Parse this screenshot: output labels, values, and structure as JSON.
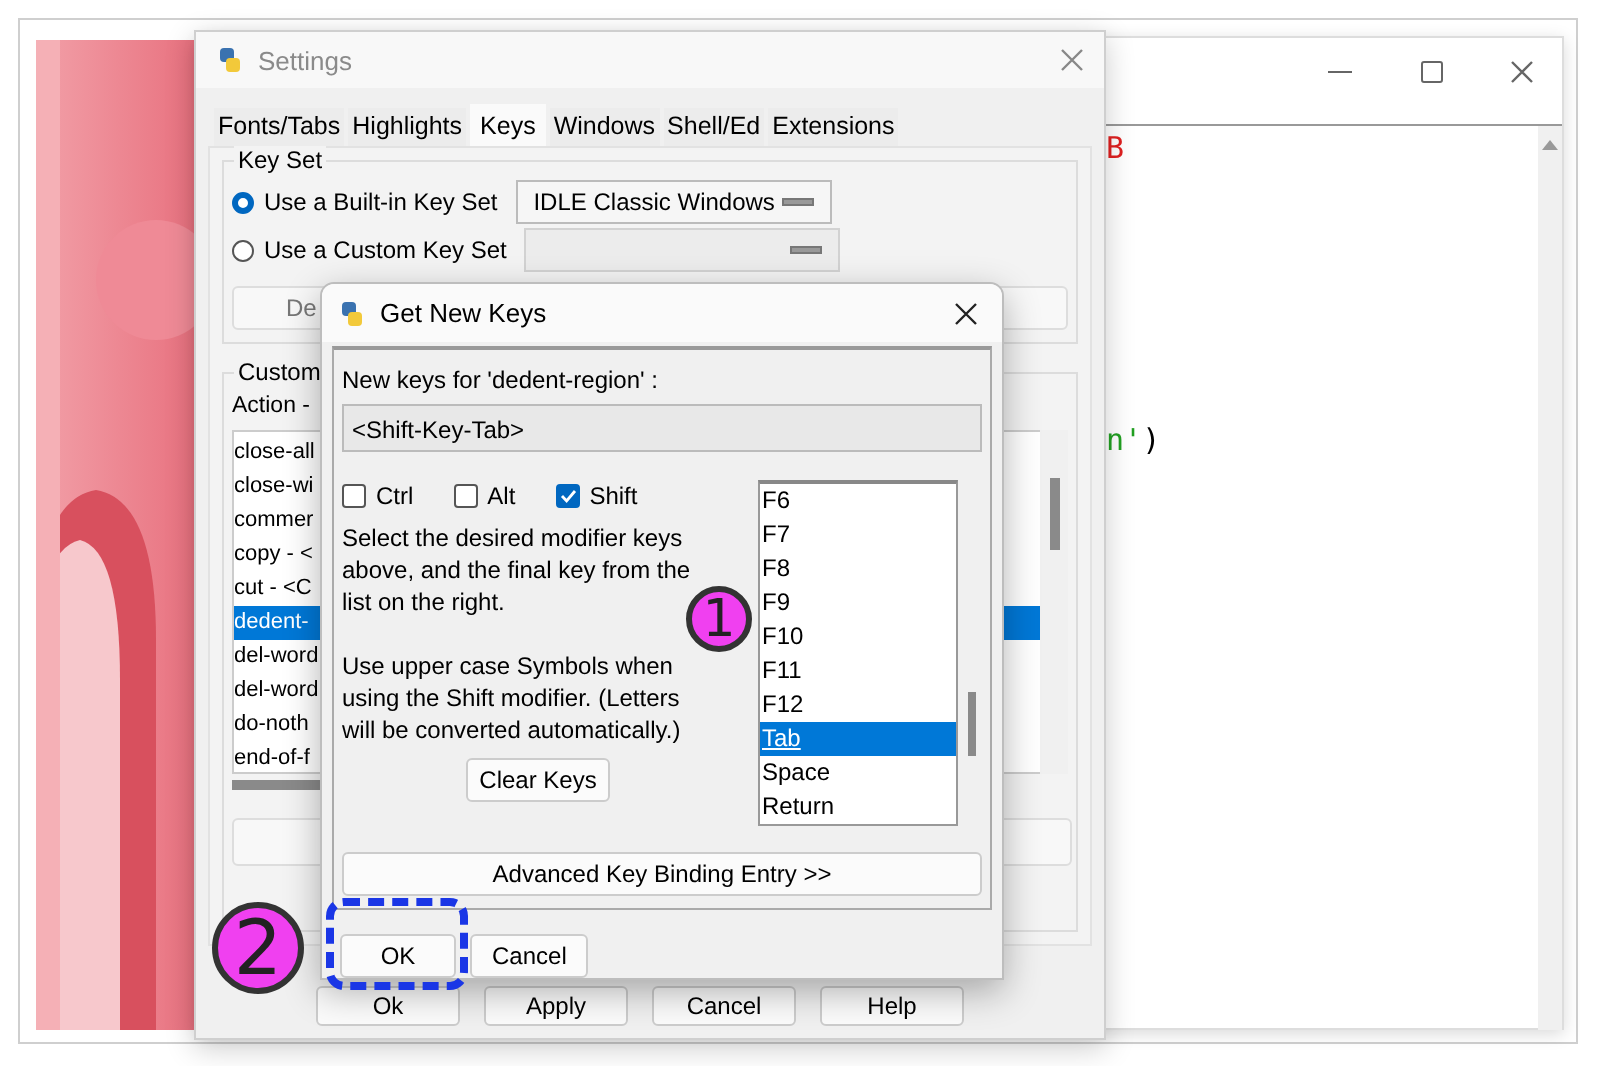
{
  "editor": {
    "code_lines": [
      [
        {
          "text": "B",
          "color": "#e02020"
        }
      ],
      [
        {
          "text": "n'",
          "color": "#22a022"
        },
        {
          "text": ")",
          "color": "#000000"
        }
      ]
    ]
  },
  "settings": {
    "title": "Settings",
    "tabs": [
      {
        "label": "Fonts/Tabs",
        "selected": false
      },
      {
        "label": "Highlights",
        "selected": false
      },
      {
        "label": "Keys",
        "selected": true
      },
      {
        "label": "Windows",
        "selected": false
      },
      {
        "label": "Shell/Ed",
        "selected": false
      },
      {
        "label": "Extensions",
        "selected": false
      }
    ],
    "key_set": {
      "legend": "Key Set",
      "options": [
        {
          "label": "Use a Built-in Key Set",
          "selected": true,
          "dropdown": "IDLE Classic Windows",
          "disabled": false
        },
        {
          "label": "Use a Custom Key Set",
          "selected": false,
          "disabled": true
        }
      ],
      "button": "De"
    },
    "custom": {
      "legend": "Custom",
      "header": "Action -",
      "actions": [
        {
          "label": "close-all",
          "selected": false
        },
        {
          "label": "close-wi",
          "selected": false
        },
        {
          "label": "commer",
          "selected": false
        },
        {
          "label": "copy - <",
          "selected": false
        },
        {
          "label": "cut - <C",
          "selected": false
        },
        {
          "label": "dedent-",
          "selected": true
        },
        {
          "label": "del-word",
          "selected": false
        },
        {
          "label": "del-word",
          "selected": false
        },
        {
          "label": "do-noth",
          "selected": false
        },
        {
          "label": "end-of-f",
          "selected": false
        }
      ]
    },
    "buttons": [
      "Ok",
      "Apply",
      "Cancel",
      "Help"
    ]
  },
  "dialog": {
    "title": "Get New Keys",
    "prompt": "New keys for 'dedent-region' :",
    "keys_value": "<Shift-Key-Tab>",
    "modifiers": [
      {
        "label": "Ctrl",
        "checked": false
      },
      {
        "label": "Alt",
        "checked": false
      },
      {
        "label": "Shift",
        "checked": true
      }
    ],
    "help_text": [
      "Select the desired modifier keys above, and the final key from the list on the right.",
      "Use upper case Symbols when using the Shift modifier.  (Letters will be converted automatically.)"
    ],
    "clear_button": "Clear Keys",
    "keys": [
      {
        "label": "F6",
        "selected": false
      },
      {
        "label": "F7",
        "selected": false
      },
      {
        "label": "F8",
        "selected": false
      },
      {
        "label": "F9",
        "selected": false
      },
      {
        "label": "F10",
        "selected": false
      },
      {
        "label": "F11",
        "selected": false
      },
      {
        "label": "F12",
        "selected": false
      },
      {
        "label": "Tab",
        "selected": true
      },
      {
        "label": "Space",
        "selected": false
      },
      {
        "label": "Return",
        "selected": false
      }
    ],
    "advanced_button": "Advanced Key Binding Entry >>",
    "buttons": [
      "OK",
      "Cancel"
    ]
  },
  "annotations": [
    {
      "number": "1"
    },
    {
      "number": "2"
    }
  ]
}
